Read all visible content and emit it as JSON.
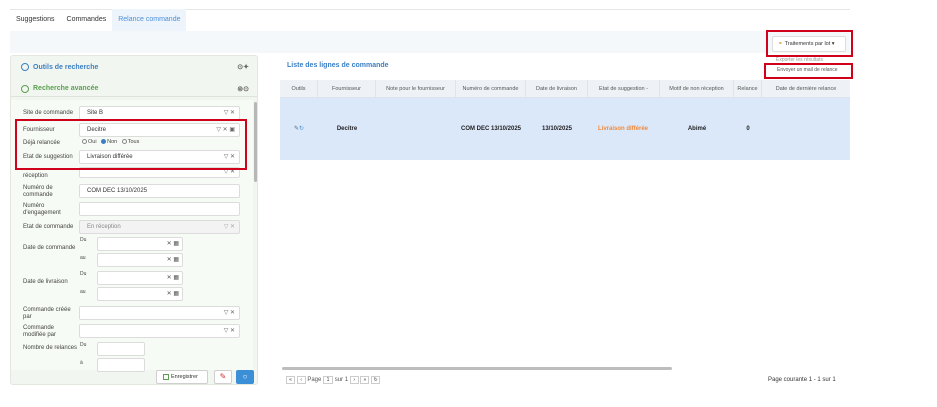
{
  "tabs": [
    "Suggestions",
    "Commandes",
    "Relance commande"
  ],
  "left": {
    "title": "Outils de recherche",
    "subtitle": "Recherche avancée",
    "fields": {
      "site_label": "Site de commande",
      "site_value": "Site B",
      "fournisseur_label": "Fournisseur",
      "fournisseur_value": "Decitre",
      "deja_label": "Déjà relancée",
      "deja_options": [
        "Oui",
        "Non",
        "Tous"
      ],
      "etat_sugg_label": "Etat de suggestion",
      "etat_sugg_value": "Livraison différée",
      "motif_label": "réception",
      "numero_label": "Numéro de commande",
      "numero_value": "COM DEC 13/10/2025",
      "engagement_label": "Numéro d'engagement",
      "etat_cmd_label": "Etat de commande",
      "etat_cmd_value": "En réception",
      "date_cmd_label": "Date de commande",
      "date_liv_label": "Date de livraison",
      "du": "Du",
      "au": "au",
      "cree_par_label": "Commande créée par",
      "modif_par_label": "Commande modifiée par",
      "nb_relances_label": "Nombre de relances",
      "a": "à"
    },
    "buttons": {
      "save": "Enregistrer"
    }
  },
  "right": {
    "title": "Liste des lignes de commande",
    "columns": [
      "Outils",
      "Fournisseur",
      "Note pour le fournisseur",
      "Numéro de commande",
      "Date de livraison",
      "Etat de suggestion -",
      "Motif de non réception",
      "Relance",
      "Date de dernière relance"
    ],
    "row": {
      "fournisseur": "Decitre",
      "numero": "COM DEC 13/10/2025",
      "date_liv": "13/10/2025",
      "etat": "Livraison différée",
      "motif": "Abimé",
      "relance": "0"
    },
    "pager": {
      "page_label": "Page",
      "page_value": "1",
      "sur": "sur 1",
      "summary": "Page courante 1 - 1 sur 1"
    },
    "actions": {
      "lot_button": "Traitements par lot",
      "menu_export": "Exporter les résultats",
      "menu_mail": "Envoyer un mail de relance"
    }
  }
}
